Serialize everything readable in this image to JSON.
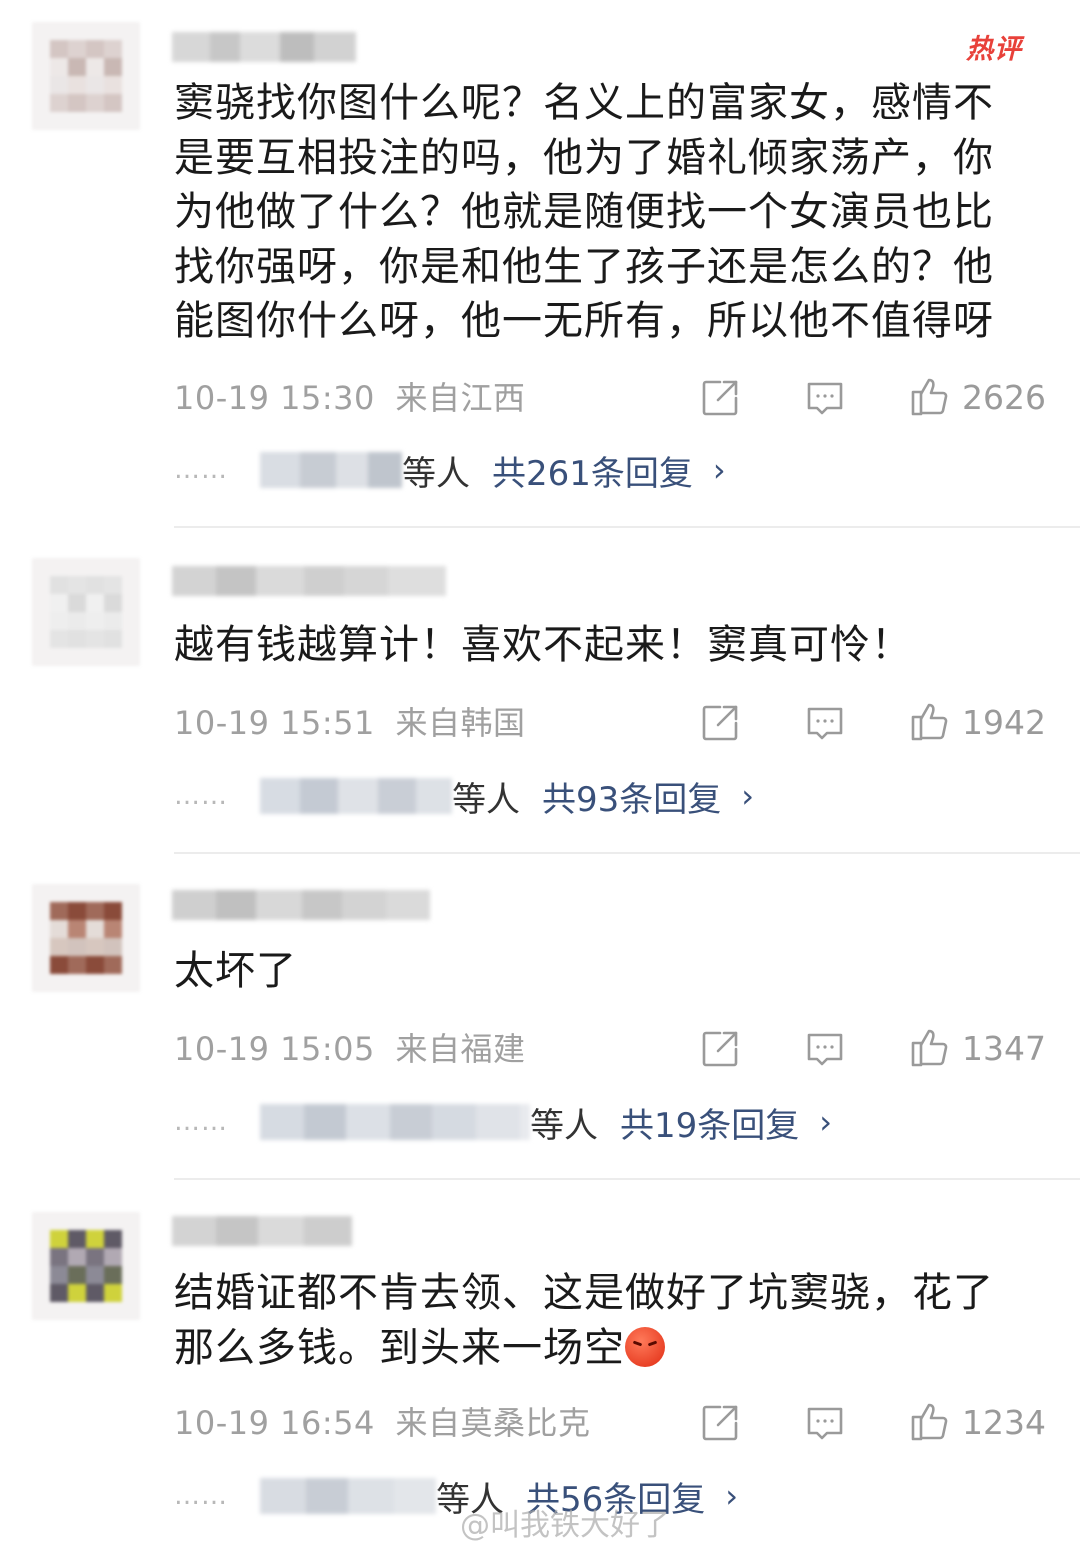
{
  "hot_badge": "热评",
  "comments": [
    {
      "text": "窦骁找你图什么呢？名义上的富家女，感情不是要互相投注的吗，他为了婚礼倾家荡产，你为他做了什么？他就是随便找一个女演员也比找你强呀，你是和他生了孩子还是怎么的？他能图你什么呀，他一无所有，所以他不值得呀",
      "time": "10-19 15:30",
      "location": "来自江西",
      "likes": "2626",
      "reply_who": "等人",
      "reply_count": "共261条回复",
      "avatar_colors": [
        "#eae6e6",
        "#ddd2d0",
        "#c9b8b4",
        "#e9e1df",
        "#d4c6c3",
        "#ede8e7"
      ]
    },
    {
      "text": "越有钱越算计！喜欢不起来！窦真可怜！",
      "time": "10-19 15:51",
      "location": "来自韩国",
      "likes": "1942",
      "reply_who": "等人",
      "reply_count": "共93条回复",
      "avatar_colors": [
        "#eeeeee",
        "#e4e4e4",
        "#dadada",
        "#ebebeb",
        "#e1e1e1",
        "#f0f0f0"
      ]
    },
    {
      "text": "太坏了",
      "time": "10-19 15:05",
      "location": "来自福建",
      "likes": "1347",
      "reply_who": "等人",
      "reply_count": "共19条回复",
      "avatar_colors": [
        "#d7c7bf",
        "#8a4b3a",
        "#b98574",
        "#d2c3bd",
        "#a06a5a",
        "#e4dcd8"
      ]
    },
    {
      "text_line1": "结婚证都不肯去领、这是做好了坑窦骁，花了",
      "text_line2": "那么多钱。到头来一场空",
      "time": "10-19 16:54",
      "location": "来自莫桑比克",
      "likes": "1234",
      "reply_who": "等人",
      "reply_count": "共56条回复",
      "avatar_colors": [
        "#8c8a96",
        "#5f5a66",
        "#b1a9b3",
        "#6a6e5a",
        "#cfd23c",
        "#7a7480"
      ]
    }
  ],
  "chevron": "›",
  "dots": "……",
  "icon_names": [
    "share-icon",
    "comment-icon",
    "like-icon"
  ],
  "watermark": "@叫我铁大好了"
}
